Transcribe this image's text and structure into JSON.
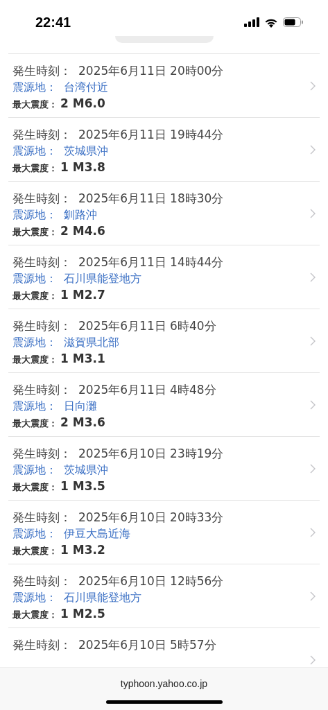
{
  "status_bar": {
    "time": "22:41"
  },
  "quakes": [
    {
      "time_label": "発生時刻：",
      "time": "2025年6月11日 20時00分",
      "epicenter_label": "震源地：",
      "epicenter": "台湾付近",
      "intensity_label": "最大震度：",
      "intensity": "2 M6.0"
    },
    {
      "time_label": "発生時刻：",
      "time": "2025年6月11日 19時44分",
      "epicenter_label": "震源地：",
      "epicenter": "茨城県沖",
      "intensity_label": "最大震度：",
      "intensity": "1 M3.8"
    },
    {
      "time_label": "発生時刻：",
      "time": "2025年6月11日 18時30分",
      "epicenter_label": "震源地：",
      "epicenter": "釧路沖",
      "intensity_label": "最大震度：",
      "intensity": "2 M4.6"
    },
    {
      "time_label": "発生時刻：",
      "time": "2025年6月11日 14時44分",
      "epicenter_label": "震源地：",
      "epicenter": "石川県能登地方",
      "intensity_label": "最大震度：",
      "intensity": "1 M2.7"
    },
    {
      "time_label": "発生時刻：",
      "time": "2025年6月11日 6時40分",
      "epicenter_label": "震源地：",
      "epicenter": "滋賀県北部",
      "intensity_label": "最大震度：",
      "intensity": "1 M3.1"
    },
    {
      "time_label": "発生時刻：",
      "time": "2025年6月11日 4時48分",
      "epicenter_label": "震源地：",
      "epicenter": "日向灘",
      "intensity_label": "最大震度：",
      "intensity": "2 M3.6"
    },
    {
      "time_label": "発生時刻：",
      "time": "2025年6月10日 23時19分",
      "epicenter_label": "震源地：",
      "epicenter": "茨城県沖",
      "intensity_label": "最大震度：",
      "intensity": "1 M3.5"
    },
    {
      "time_label": "発生時刻：",
      "time": "2025年6月10日 20時33分",
      "epicenter_label": "震源地：",
      "epicenter": "伊豆大島近海",
      "intensity_label": "最大震度：",
      "intensity": "1 M3.2"
    },
    {
      "time_label": "発生時刻：",
      "time": "2025年6月10日 12時56分",
      "epicenter_label": "震源地：",
      "epicenter": "石川県能登地方",
      "intensity_label": "最大震度：",
      "intensity": "1 M2.5"
    },
    {
      "time_label": "発生時刻：",
      "time": "2025年6月10日 5時57分"
    }
  ],
  "address_bar": {
    "url": "typhoon.yahoo.co.jp"
  }
}
